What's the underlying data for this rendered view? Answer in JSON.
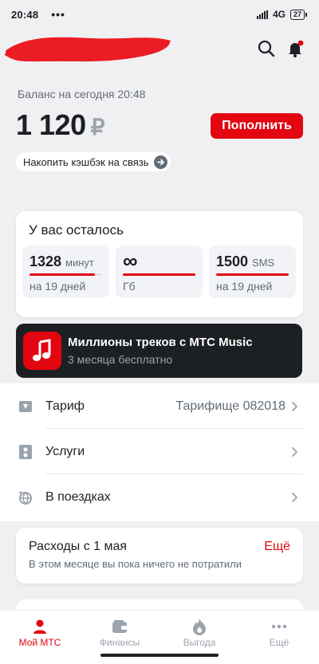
{
  "status_bar": {
    "time": "20:48",
    "network": "4G",
    "battery": "27"
  },
  "balance": {
    "caption": "Баланс на сегодня 20:48",
    "amount": "1 120",
    "currency": "₽",
    "topup_label": "Пополнить"
  },
  "cashback": {
    "label": "Накопить кэшбэк на связь"
  },
  "remaining": {
    "title": "У вас осталось",
    "tiles": [
      {
        "value": "1328",
        "unit": "минут",
        "sub": "на 19 дней",
        "fill": 0.9
      },
      {
        "value": "∞",
        "unit": "",
        "sub": "Гб",
        "fill": 1.0
      },
      {
        "value": "1500",
        "unit": "SMS",
        "sub": "на 19 дней",
        "fill": 1.0
      }
    ]
  },
  "promo": {
    "title": "Миллионы треков с МТС Music",
    "subtitle": "3 месяца бесплатно"
  },
  "menu": [
    {
      "label": "Тариф",
      "value": "Тарифище 082018",
      "icon": "wallet-card-icon"
    },
    {
      "label": "Услуги",
      "value": "",
      "icon": "services-icon"
    },
    {
      "label": "В поездках",
      "value": "",
      "icon": "globe-plane-icon"
    }
  ],
  "expenses": {
    "title": "Расходы с 1 мая",
    "more": "Ещё",
    "subtitle": "В этом месяце вы пока ничего не потратили"
  },
  "tabbar": [
    {
      "label": "Мой МТС",
      "icon": "person-icon",
      "active": true
    },
    {
      "label": "Финансы",
      "icon": "wallet-icon",
      "active": false
    },
    {
      "label": "Выгода",
      "icon": "flame-icon",
      "active": false
    },
    {
      "label": "Ещё",
      "icon": "more-dots-icon",
      "active": false
    }
  ],
  "colors": {
    "accent": "#e30611",
    "dark": "#1d2023",
    "muted": "#626c77",
    "background": "#f0f0f3"
  }
}
